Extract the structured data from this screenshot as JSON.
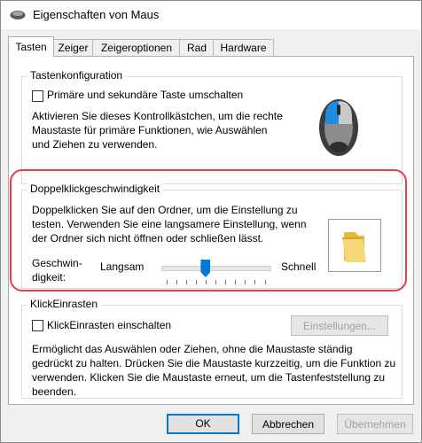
{
  "window": {
    "title": "Eigenschaften von Maus"
  },
  "tabs": [
    {
      "label": "Tasten"
    },
    {
      "label": "Zeiger"
    },
    {
      "label": "Zeigeroptionen"
    },
    {
      "label": "Rad"
    },
    {
      "label": "Hardware"
    }
  ],
  "tastenkonfiguration": {
    "title": "Tastenkonfiguration",
    "checkbox_label": "Primäre und sekundäre Taste umschalten",
    "desc": [
      "Aktivieren Sie dieses Kontrollkästchen, um die rechte",
      "Maustaste für primäre Funktionen, wie Auswählen",
      "und Ziehen zu verwenden."
    ]
  },
  "doppelklick": {
    "title": "Doppelklickgeschwindigkeit",
    "desc": [
      "Doppelklicken Sie auf den Ordner, um die Einstellung zu",
      "testen. Verwenden Sie eine langsamere Einstellung, wenn",
      "der Ordner sich nicht öffnen oder schließen lässt."
    ],
    "speed_label": [
      "Geschwin-",
      "digkeit:"
    ],
    "slow": "Langsam",
    "fast": "Schnell",
    "slider_level": 0.4
  },
  "klickeinrasten": {
    "title": "KlickEinrasten",
    "checkbox_label": "KlickEinrasten einschalten",
    "settings_button": "Einstellungen...",
    "desc": [
      "Ermöglicht das Auswählen oder Ziehen, ohne die Maustaste ständig",
      "gedrückt zu halten. Drücken Sie die Maustaste kurzzeitig, um die Funktion zu",
      "verwenden. Klicken Sie die Maustaste erneut, um die Tastenfeststellung zu",
      "beenden."
    ]
  },
  "footer": {
    "ok": "OK",
    "cancel": "Abbrechen",
    "apply": "Übernehmen"
  }
}
